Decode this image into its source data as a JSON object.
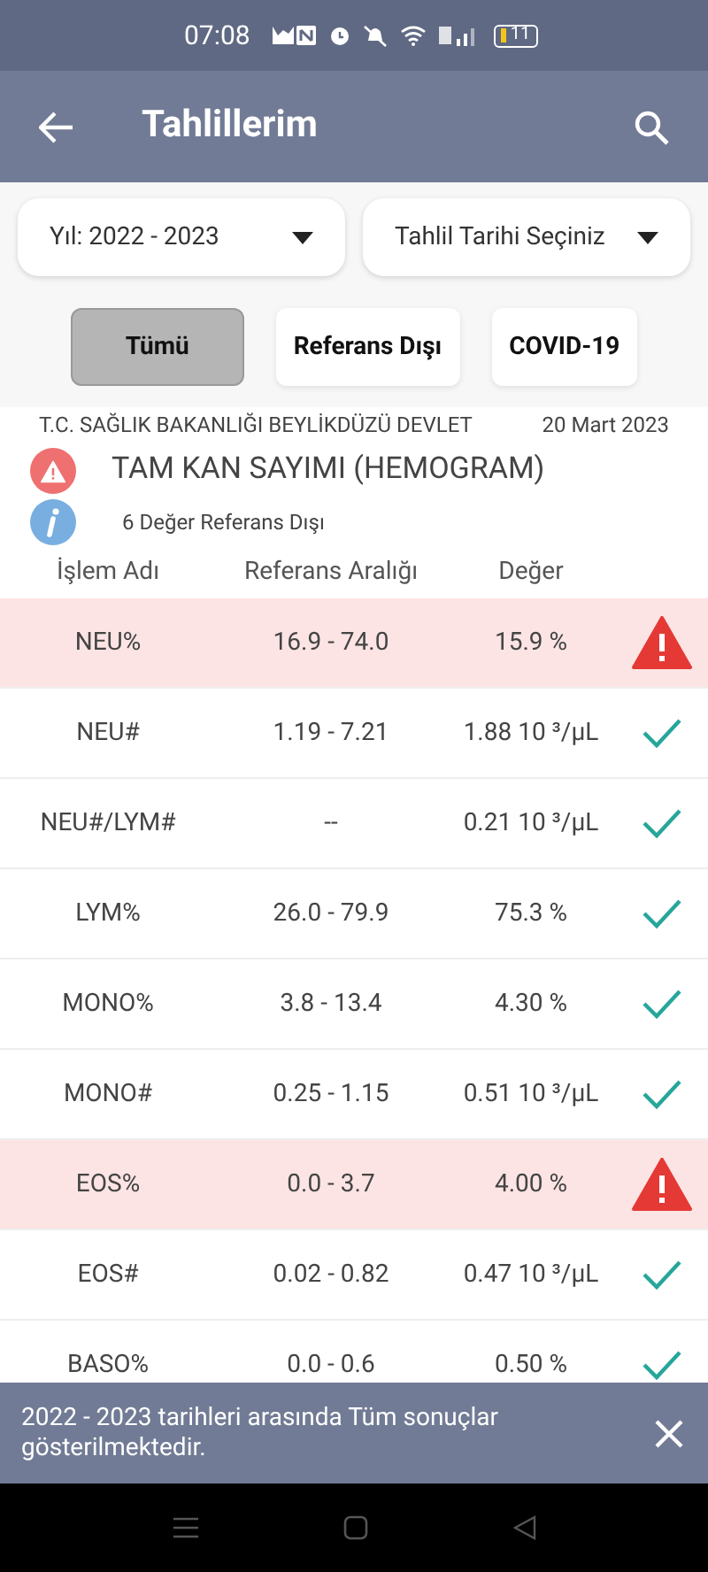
{
  "status_bar": {
    "time": "07:08",
    "battery": "11"
  },
  "app_bar": {
    "title": "Tahlillerim"
  },
  "filters": [
    {
      "label": "Yıl: 2022 - 2023"
    },
    {
      "label": "Tahlil Tarihi Seçiniz"
    }
  ],
  "tabs": [
    {
      "label": "Tümü",
      "selected": true
    },
    {
      "label": "Referans Dışı",
      "selected": false
    },
    {
      "label": "COVID-19",
      "selected": false
    }
  ],
  "report": {
    "hospital": "T.C. SAĞLIK BAKANLIĞI BEYLİKDÜZÜ DEVLET",
    "date": "20 Mart 2023",
    "title": "TAM KAN SAYIMI (HEMOGRAM)",
    "info": "6 Değer Referans Dışı"
  },
  "table": {
    "columns": [
      "İşlem Adı",
      "Referans Aralığı",
      "Değer"
    ],
    "rows": [
      {
        "name": "NEU%",
        "range": "16.9 - 74.0",
        "value": "15.9 %",
        "flagged": true
      },
      {
        "name": "NEU#",
        "range": "1.19 - 7.21",
        "value": "1.88 10 ³/µL",
        "flagged": false
      },
      {
        "name": "NEU#/LYM#",
        "range": "--",
        "value": "0.21 10 ³/µL",
        "flagged": false
      },
      {
        "name": "LYM%",
        "range": "26.0 - 79.9",
        "value": "75.3 %",
        "flagged": false
      },
      {
        "name": "MONO%",
        "range": "3.8 - 13.4",
        "value": "4.30 %",
        "flagged": false
      },
      {
        "name": "MONO#",
        "range": "0.25 - 1.15",
        "value": "0.51 10 ³/µL",
        "flagged": false
      },
      {
        "name": "EOS%",
        "range": "0.0 - 3.7",
        "value": "4.00 %",
        "flagged": true
      },
      {
        "name": "EOS#",
        "range": "0.02 - 0.82",
        "value": "0.47 10 ³/µL",
        "flagged": false
      },
      {
        "name": "BASO%",
        "range": "0.0 - 0.6",
        "value": "0.50 %",
        "flagged": false
      }
    ]
  },
  "snackbar": {
    "message": "2022 - 2023 tarihleri arasında Tüm sonuçlar gösterilmektedir."
  }
}
